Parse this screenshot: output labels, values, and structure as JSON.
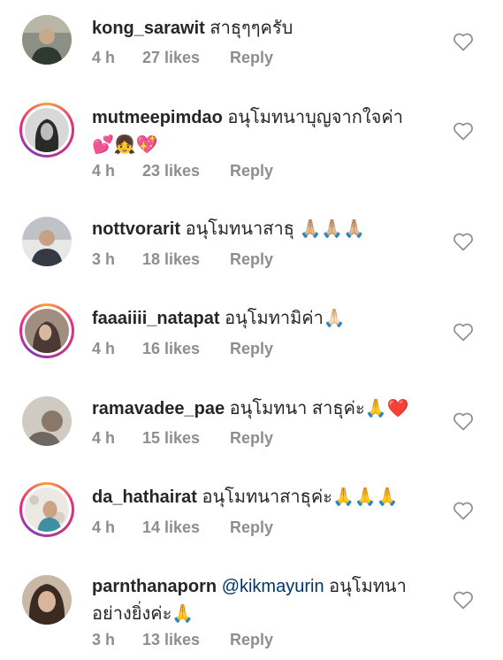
{
  "comments": [
    {
      "username": "kong_sarawit",
      "text": "สาธุๆๆครับ",
      "time": "4 h",
      "likes": "27 likes",
      "reply": "Reply",
      "story": false
    },
    {
      "username": "mutmeepimdao",
      "text": "อนุโมทนาบุญจากใจค่า",
      "emoji": "💕👧💖",
      "time": "4 h",
      "likes": "23 likes",
      "reply": "Reply",
      "story": true
    },
    {
      "username": "nottvorarit",
      "text": "อนุโมทนาสาธุ",
      "emoji": "🙏🏼🙏🏼🙏🏼",
      "time": "3 h",
      "likes": "18 likes",
      "reply": "Reply",
      "story": false
    },
    {
      "username": "faaaiiii_natapat",
      "text": "อนุโมทามิค่า",
      "emoji": "🙏🏻",
      "time": "4 h",
      "likes": "16 likes",
      "reply": "Reply",
      "story": true
    },
    {
      "username": "ramavadee_pae",
      "text": "อนุโมทนา สาธุค่ะ",
      "emoji": "🙏❤️",
      "time": "4 h",
      "likes": "15 likes",
      "reply": "Reply",
      "story": false
    },
    {
      "username": "da_hathairat",
      "text": "อนุโมทนาสาธุค่ะ",
      "emoji": "🙏🙏🙏",
      "time": "4 h",
      "likes": "14 likes",
      "reply": "Reply",
      "story": true
    },
    {
      "username": "parnthanaporn",
      "mention": "@kikmayurin",
      "text": "อนุโมทนาอย่างยิ่งค่ะ",
      "emoji": "🙏",
      "time": "3 h",
      "likes": "13 likes",
      "reply": "Reply",
      "story": false
    }
  ]
}
